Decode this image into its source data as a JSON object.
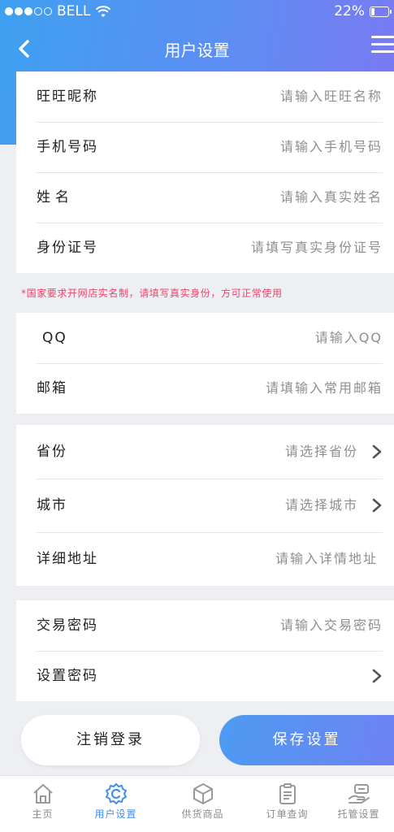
{
  "status_bar": {
    "carrier": "BELL",
    "battery_text": "22%",
    "battery_level": 0.22
  },
  "nav": {
    "title": "用户设置",
    "back_icon": "chevron-left-icon",
    "menu_icon": "hamburger-menu-icon"
  },
  "identity_section": [
    {
      "label": "旺旺昵称",
      "placeholder": "请输入旺旺名称"
    },
    {
      "label": "手机号码",
      "placeholder": "请输入手机号码"
    },
    {
      "label": "姓名",
      "placeholder": "请输入真实姓名"
    },
    {
      "label": "身份证号",
      "placeholder": "请填写真实身份证号"
    }
  ],
  "notice": "*国家要求开网店实名制，请填写真实身份，方可正常使用",
  "contact_section": [
    {
      "label": "QQ",
      "placeholder": "请输入QQ"
    },
    {
      "label": "邮箱",
      "placeholder": "请填输入常用邮箱"
    }
  ],
  "address_section": [
    {
      "label": "省份",
      "placeholder": "请选择省份"
    },
    {
      "label": "城市",
      "placeholder": "请选择城市"
    },
    {
      "label": "详细地址",
      "placeholder": "请输入详情地址"
    }
  ],
  "password_section": [
    {
      "label": "交易密码",
      "placeholder": "请输入交易密码"
    },
    {
      "label": "设置密码"
    }
  ],
  "buttons": {
    "logout": "注销登录",
    "save": "保存设置"
  },
  "tabs": [
    {
      "label": "主页",
      "icon": "home-icon",
      "active": false
    },
    {
      "label": "用户设置",
      "icon": "user-settings-icon",
      "active": true
    },
    {
      "label": "供货商品",
      "icon": "box-icon",
      "active": false
    },
    {
      "label": "订单查询",
      "icon": "clipboard-icon",
      "active": false
    },
    {
      "label": "托管设置",
      "icon": "hand-coin-icon",
      "active": false
    }
  ],
  "colors": {
    "accent": "#3f8ef2",
    "notice": "#f1416a",
    "gradient_start": "#3ea0f1",
    "gradient_end": "#7c78f2"
  }
}
